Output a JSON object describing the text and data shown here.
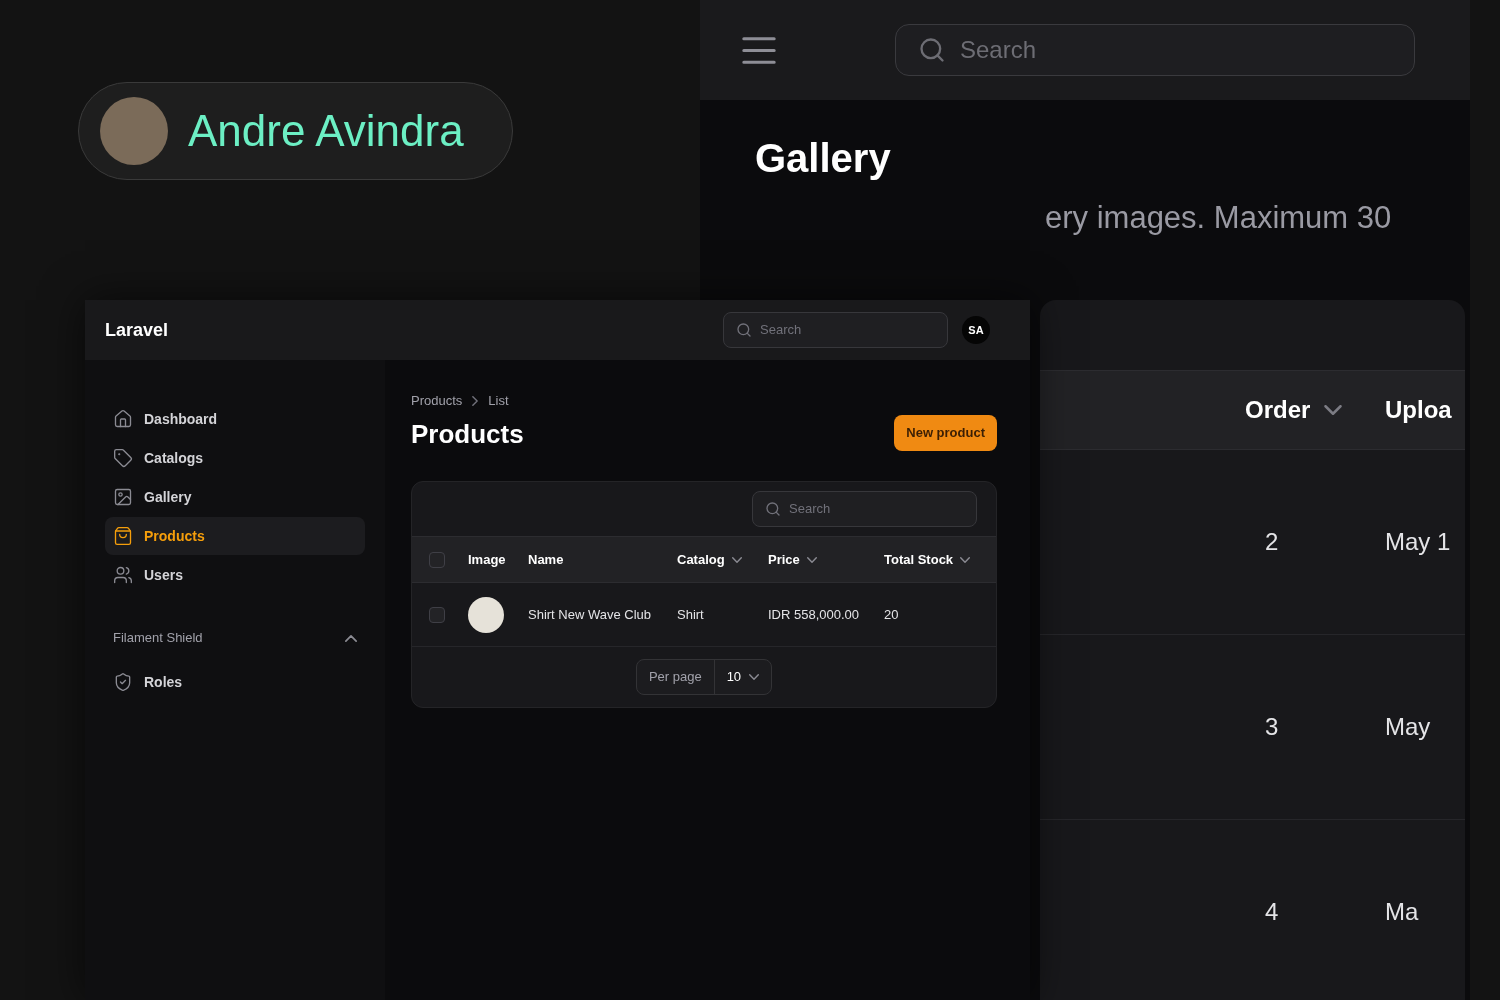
{
  "author_badge": {
    "name": "Andre Avindra"
  },
  "gallery_window": {
    "search": {
      "placeholder": "Search"
    },
    "title": "Gallery",
    "description": "ery images. Maximum 30",
    "table": {
      "columns": [
        {
          "label": "Order",
          "sortable": true
        },
        {
          "label": "Uploa",
          "sortable": false
        }
      ],
      "rows": [
        {
          "cells": [
            "2",
            "May 1"
          ]
        },
        {
          "cells": [
            "3",
            "May"
          ]
        },
        {
          "cells": [
            "4",
            "Ma"
          ]
        }
      ]
    }
  },
  "app_window": {
    "brand": "Laravel",
    "search": {
      "placeholder": "Search"
    },
    "user": {
      "initials": "SA"
    },
    "sidebar": {
      "items": [
        {
          "label": "Dashboard",
          "selected": false
        },
        {
          "label": "Catalogs",
          "selected": false
        },
        {
          "label": "Gallery",
          "selected": false
        },
        {
          "label": "Products",
          "selected": true
        },
        {
          "label": "Users",
          "selected": false
        }
      ],
      "groups": [
        {
          "label": "Filament Shield",
          "expanded": true,
          "items": [
            {
              "label": "Roles",
              "selected": false
            }
          ]
        }
      ]
    },
    "breadcrumbs": [
      "Products",
      "List"
    ],
    "title": "Products",
    "primary_action": "New product",
    "table": {
      "search": {
        "placeholder": "Search"
      },
      "select_all": {
        "checked": false
      },
      "columns": [
        {
          "label": "Image",
          "sortable": false
        },
        {
          "label": "Name",
          "sortable": false
        },
        {
          "label": "Catalog",
          "sortable": true
        },
        {
          "label": "Price",
          "sortable": true
        },
        {
          "label": "Total Stock",
          "sortable": true
        }
      ],
      "rows": [
        {
          "selected": false,
          "cells": [
            {
              "kind": "photo"
            },
            {
              "kind": "text",
              "text": "Shirt New Wave Club"
            },
            {
              "kind": "text",
              "text": "Shirt"
            },
            {
              "kind": "text",
              "text": "IDR 558,000.00"
            },
            {
              "kind": "text",
              "text": "20"
            }
          ]
        }
      ],
      "pagination": {
        "label": "Per page",
        "value": "10"
      }
    }
  }
}
